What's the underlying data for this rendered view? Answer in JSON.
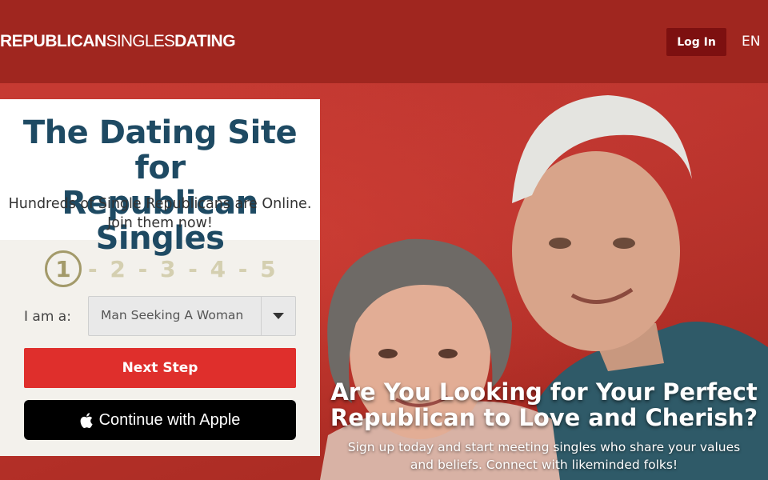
{
  "header": {
    "logo": {
      "part1": "REPUBLICAN",
      "part2": "SINGLES",
      "part3": "DATING"
    },
    "login_label": "Log In",
    "language": "EN"
  },
  "card": {
    "title_line1": "The Dating Site for",
    "title_line2": "Republican Singles",
    "subtitle_line1": "Hundreds of Single Republicans are Online.",
    "subtitle_line2": "Join them now!",
    "steps": {
      "current": "1",
      "rest": "- 2 - 3 - 4 - 5"
    },
    "iam_label": "I am a:",
    "select_value": "Man Seeking A Woman",
    "next_label": "Next Step",
    "apple_label": "Continue with Apple"
  },
  "hero": {
    "headline_line1": "Are You Looking for Your Perfect",
    "headline_line2": "Republican to Love and Cherish?",
    "sub_line1": "Sign up today and start meeting singles who share your values",
    "sub_line2": "and beliefs. Connect with likeminded folks!"
  },
  "colors": {
    "header": "#a0261f",
    "accent_red": "#df2f2c",
    "login_bg": "#7d1010",
    "title_blue": "#1e4a63",
    "step_gold": "#a39a6a"
  }
}
